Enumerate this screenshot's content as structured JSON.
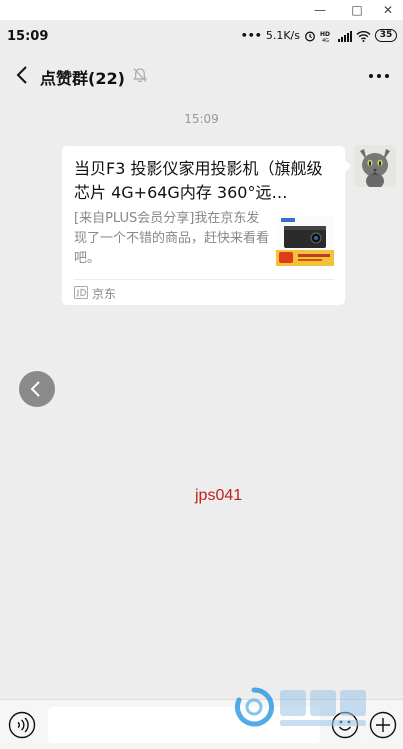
{
  "window": {
    "minimize": "—",
    "maximize": "□",
    "close": "✕"
  },
  "status": {
    "time": "15:09",
    "net_speed": "5.1K/s",
    "battery": "35",
    "icons": [
      "alarm-icon",
      "hd-icon",
      "signal-icon",
      "wifi-icon",
      "battery-icon"
    ]
  },
  "chat": {
    "title": "点赞群(22)",
    "muted": true
  },
  "message": {
    "time": "15:09",
    "card": {
      "title": "当贝F3 投影仪家用投影机（旗舰级芯片 4G+64G内存 360°远…",
      "description": "[来自PLUS会员分享]我在京东发现了一个不错的商品，赶快来看看吧。",
      "source": "京东"
    }
  },
  "overlay": {
    "watermark": "jps041"
  },
  "colors": {
    "background": "#ededed",
    "card": "#ffffff",
    "watermark": "#c02020",
    "logo": "#1a8fe0"
  }
}
